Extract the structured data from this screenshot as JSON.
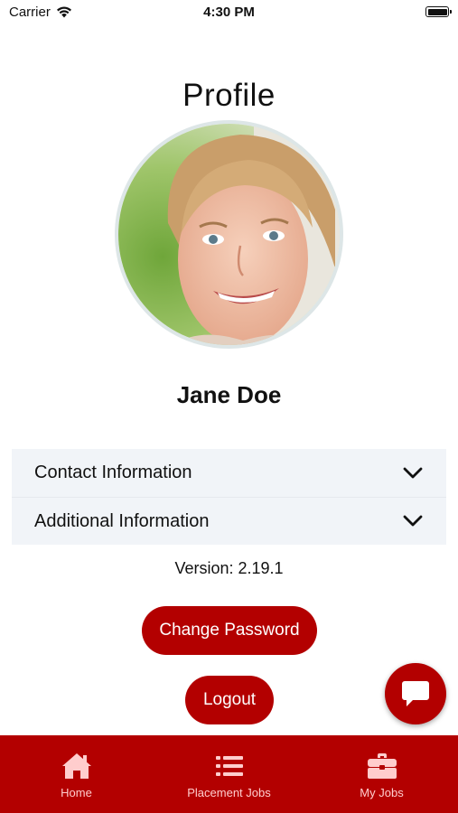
{
  "status_bar": {
    "carrier": "Carrier",
    "time": "4:30 PM"
  },
  "page": {
    "title": "Profile"
  },
  "profile": {
    "name": "Jane Doe",
    "avatar_icon": "profile-photo"
  },
  "accordion": {
    "items": [
      {
        "label": "Contact Information",
        "icon": "chevron-down-icon"
      },
      {
        "label": "Additional Information",
        "icon": "chevron-down-icon"
      }
    ]
  },
  "version_text": "Version: 2.19.1",
  "actions": {
    "change_password_label": "Change Password",
    "logout_label": "Logout"
  },
  "chat_button": {
    "icon": "chat-bubble-icon"
  },
  "tab_bar": {
    "items": [
      {
        "label": "Home",
        "icon": "home-icon"
      },
      {
        "label": "Placement Jobs",
        "icon": "list-icon"
      },
      {
        "label": "My Jobs",
        "icon": "briefcase-icon"
      }
    ]
  },
  "colors": {
    "brand": "#b30000",
    "tab_inactive": "#ffcdcd",
    "accordion_bg": "#f1f4f8"
  }
}
